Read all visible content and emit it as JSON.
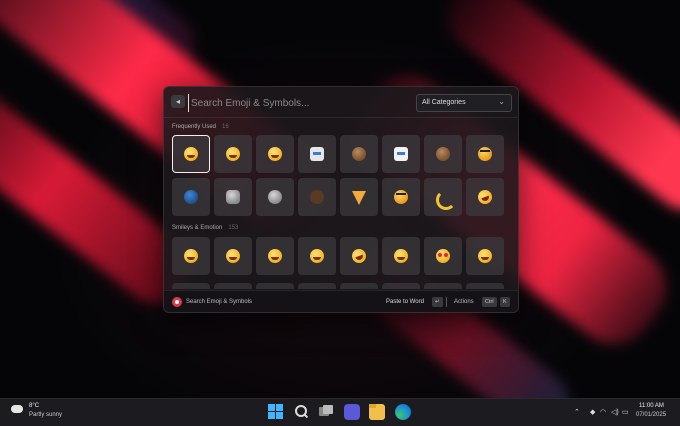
{
  "search": {
    "placeholder": "Search Emoji & Symbols...",
    "category_selected": "All Categories"
  },
  "sections": [
    {
      "title": "Frequently Used",
      "count": "16",
      "emojis": [
        "hugging-face",
        "cowboy-face",
        "face-with-mask",
        "robot",
        "monkey",
        "bunny",
        "sloth",
        "tiger",
        "woman-vampire",
        "man-office-worker",
        "astronaut",
        "bison",
        "pizza",
        "leopard",
        "banana",
        "rolling-on-floor-laughing"
      ]
    },
    {
      "title": "Smileys & Emotion",
      "count": "153",
      "emojis": [
        "grinning-face",
        "grinning-big-eyes",
        "beaming-face",
        "grinning-sweat",
        "rofl",
        "squinting-laugh",
        "heart-eyes",
        "smiling-face"
      ]
    }
  ],
  "footer": {
    "app_name": "Search Emoji & Symbols",
    "primary_action": "Paste to Word",
    "primary_key": "↵",
    "actions_label": "Actions",
    "actions_keys": [
      "Ctrl",
      "K"
    ]
  },
  "taskbar": {
    "weather_temp": "8°C",
    "weather_desc": "Partly sunny",
    "time": "11:00 AM",
    "date": "07/01/2025"
  }
}
